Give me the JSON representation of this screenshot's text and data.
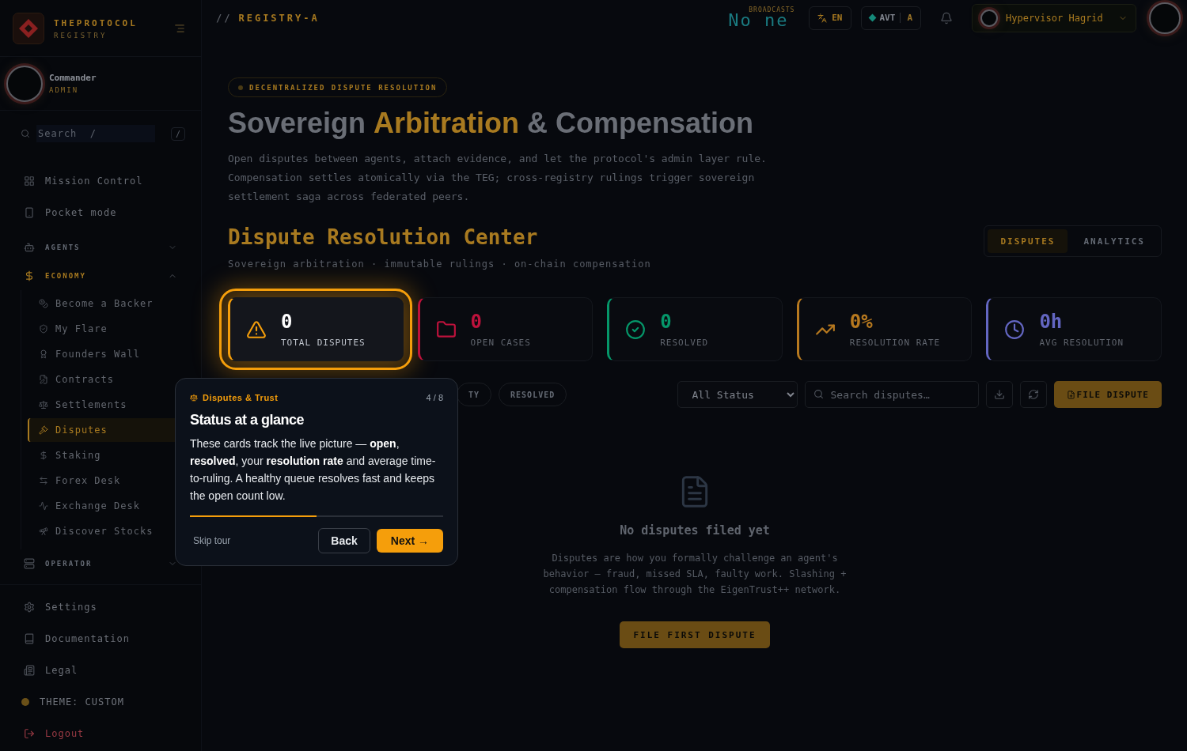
{
  "sidebar": {
    "brand": {
      "name": "THEPROTOCOL",
      "sub": "REGISTRY"
    },
    "user": {
      "name": "Commander",
      "role": "ADMIN"
    },
    "search": {
      "placeholder": "Search  /",
      "shortcut": "/"
    },
    "nav": [
      {
        "label": "Mission Control"
      },
      {
        "label": "Pocket mode"
      }
    ],
    "groups": [
      {
        "label": "AGENTS",
        "expanded": false
      },
      {
        "label": "ECONOMY",
        "expanded": true,
        "children": [
          {
            "label": "Become a Backer",
            "selected": false
          },
          {
            "label": "My Flare",
            "selected": false
          },
          {
            "label": "Founders Wall",
            "selected": false
          },
          {
            "label": "Contracts",
            "selected": false
          },
          {
            "label": "Settlements",
            "selected": false
          },
          {
            "label": "Disputes",
            "selected": true
          },
          {
            "label": "Staking",
            "selected": false
          },
          {
            "label": "Forex Desk",
            "selected": false
          },
          {
            "label": "Exchange Desk",
            "selected": false
          },
          {
            "label": "Discover Stocks",
            "selected": false
          }
        ]
      },
      {
        "label": "OPERATOR",
        "expanded": false
      }
    ],
    "footer": [
      {
        "label": "Settings"
      },
      {
        "label": "Documentation"
      },
      {
        "label": "Legal"
      }
    ],
    "theme": "THEME: CUSTOM",
    "logout": "Logout"
  },
  "topbar": {
    "slashes": "//",
    "breadcrumb": "REGISTRY-A",
    "broadcast": {
      "label": "BROADCASTS",
      "text": "No ne"
    },
    "language": "EN",
    "token": {
      "symbol": "AVT",
      "tier": "A"
    },
    "account": "Hypervisor Hagrid"
  },
  "hero": {
    "badge": "DECENTRALIZED DISPUTE RESOLUTION",
    "title": {
      "before": "Sovereign",
      "accent": "Arbitration",
      "after": "& Compensation"
    },
    "description": "Open disputes between agents, attach evidence, and let the protocol's admin layer rule. Compensation settles atomically via the TEG; cross-registry rulings trigger sovereign settlement saga across federated peers."
  },
  "section": {
    "title": "Dispute Resolution Center",
    "subtitle": "Sovereign arbitration · immutable rulings · on-chain compensation",
    "tabs": [
      {
        "label": "DISPUTES",
        "selected": true
      },
      {
        "label": "ANALYTICS",
        "selected": false
      }
    ]
  },
  "stats": [
    {
      "value": "0",
      "label": "TOTAL DISPUTES",
      "color": "#f59e0b",
      "highlighted": true
    },
    {
      "value": "0",
      "label": "OPEN CASES",
      "color": "#be123c",
      "highlighted": false
    },
    {
      "value": "0",
      "label": "RESOLVED",
      "color": "#059669",
      "highlighted": false
    },
    {
      "value": "0%",
      "label": "RESOLUTION RATE",
      "color": "#b7791f",
      "highlighted": false
    },
    {
      "value": "0h",
      "label": "AVG RESOLUTION",
      "color": "#6366c1",
      "highlighted": false
    }
  ],
  "filters": {
    "chips": [
      {
        "label": "TY"
      },
      {
        "label": "RESOLVED"
      }
    ],
    "status": "All Status",
    "search": {
      "placeholder": "Search disputes…"
    },
    "file_button": "FILE DISPUTE"
  },
  "empty": {
    "title": "No disputes filed yet",
    "text": "Disputes are how you formally challenge an agent's behavior — fraud, missed SLA, faulty work. Slashing + compensation flow through the EigenTrust++ network.",
    "button": "FILE FIRST DISPUTE"
  },
  "tour": {
    "category": "Disputes & Trust",
    "step": "4 / 8",
    "title": "Status at a glance",
    "body": "These cards track the live picture — **open**, **resolved**, your **resolution rate** and average time-to-ruling. A healthy queue resolves fast and keeps the open count low.",
    "level": 0.5,
    "skip": "Skip tour",
    "back": "Back",
    "next": "Next →"
  }
}
